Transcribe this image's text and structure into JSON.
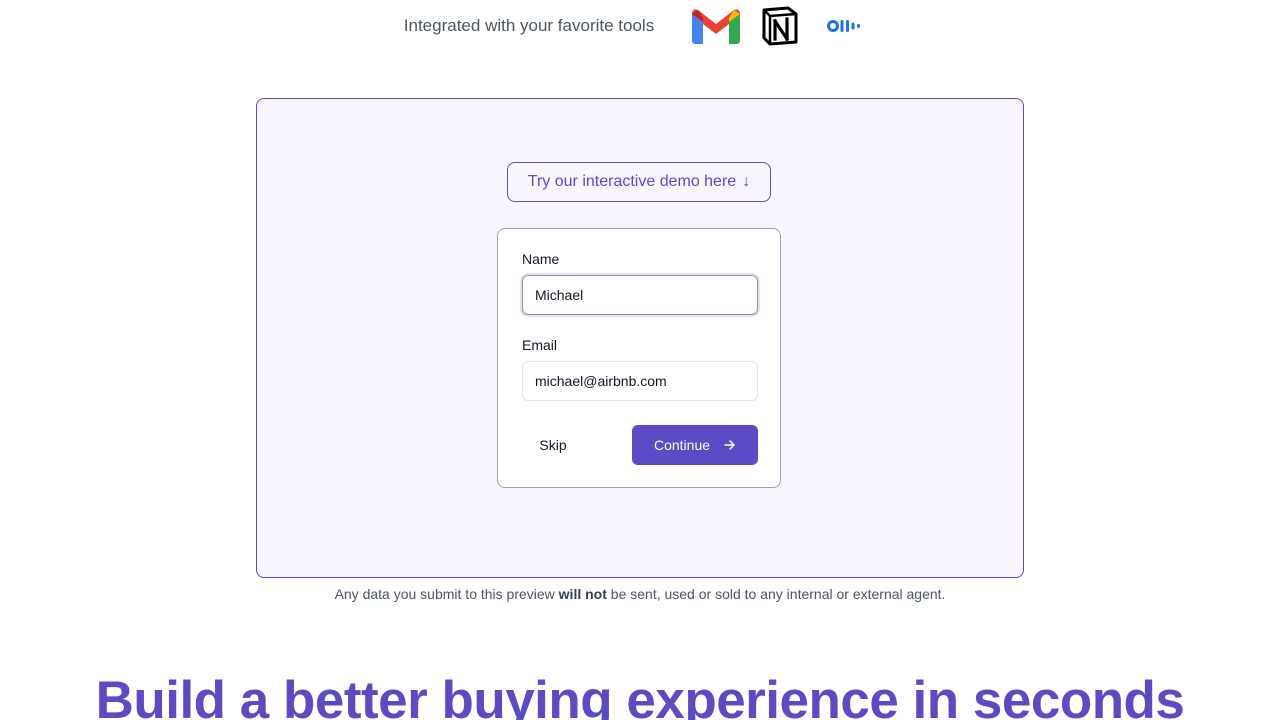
{
  "integrations": {
    "label": "Integrated with your favorite tools",
    "logos": [
      "gmail-logo",
      "notion-logo",
      "otter-logo"
    ]
  },
  "demo": {
    "pill_label": "Try our interactive demo here",
    "pill_arrow": "↓",
    "form": {
      "name_label": "Name",
      "name_value": "Michael",
      "email_label": "Email",
      "email_value": "michael@airbnb.com",
      "skip_label": "Skip",
      "continue_label": "Continue"
    }
  },
  "disclaimer": {
    "before": "Any data you submit to this preview ",
    "bold": "will not",
    "after": " be sent, used or sold to any internal or external agent."
  },
  "headline": "Build a better buying experience in seconds",
  "colors": {
    "accent": "#5b4bc4",
    "panel_bg": "#f7f5fe"
  }
}
